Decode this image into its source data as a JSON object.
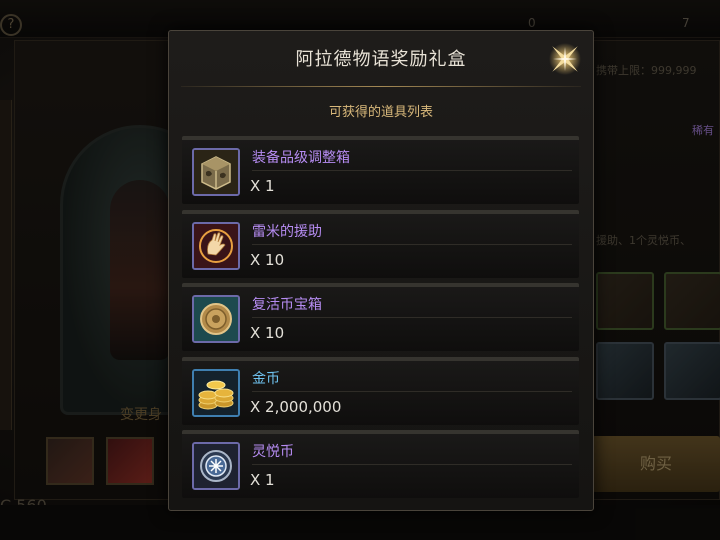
{
  "background": {
    "help_glyph": "?",
    "currency_1": "0",
    "currency_2": "7",
    "change_label": "变更身",
    "score": "C 560",
    "limit_text": "携带上限：999,999",
    "rare_text": "稀有",
    "desc_text": "援助、1个灵悦币、",
    "buy_label": "购买"
  },
  "modal": {
    "title": "阿拉德物语奖励礼盒",
    "subtitle": "可获得的道具列表",
    "close_icon": "close-star-icon",
    "items": [
      {
        "name": "装备品级调整箱",
        "quantity": "X 1",
        "icon": "mystery-box-icon",
        "name_color": "#b68cf2"
      },
      {
        "name": "雷米的援助",
        "quantity": "X 10",
        "icon": "hand-blessing-icon",
        "name_color": "#b68cf2"
      },
      {
        "name": "复活币宝箱",
        "quantity": "X 10",
        "icon": "revive-coin-icon",
        "name_color": "#b68cf2"
      },
      {
        "name": "金币",
        "quantity": "X 2,000,000",
        "icon": "gold-coins-icon",
        "name_color": "#6fc2ef"
      },
      {
        "name": "灵悦币",
        "quantity": "X 1",
        "icon": "spirit-coin-icon",
        "name_color": "#b68cf2"
      }
    ]
  }
}
